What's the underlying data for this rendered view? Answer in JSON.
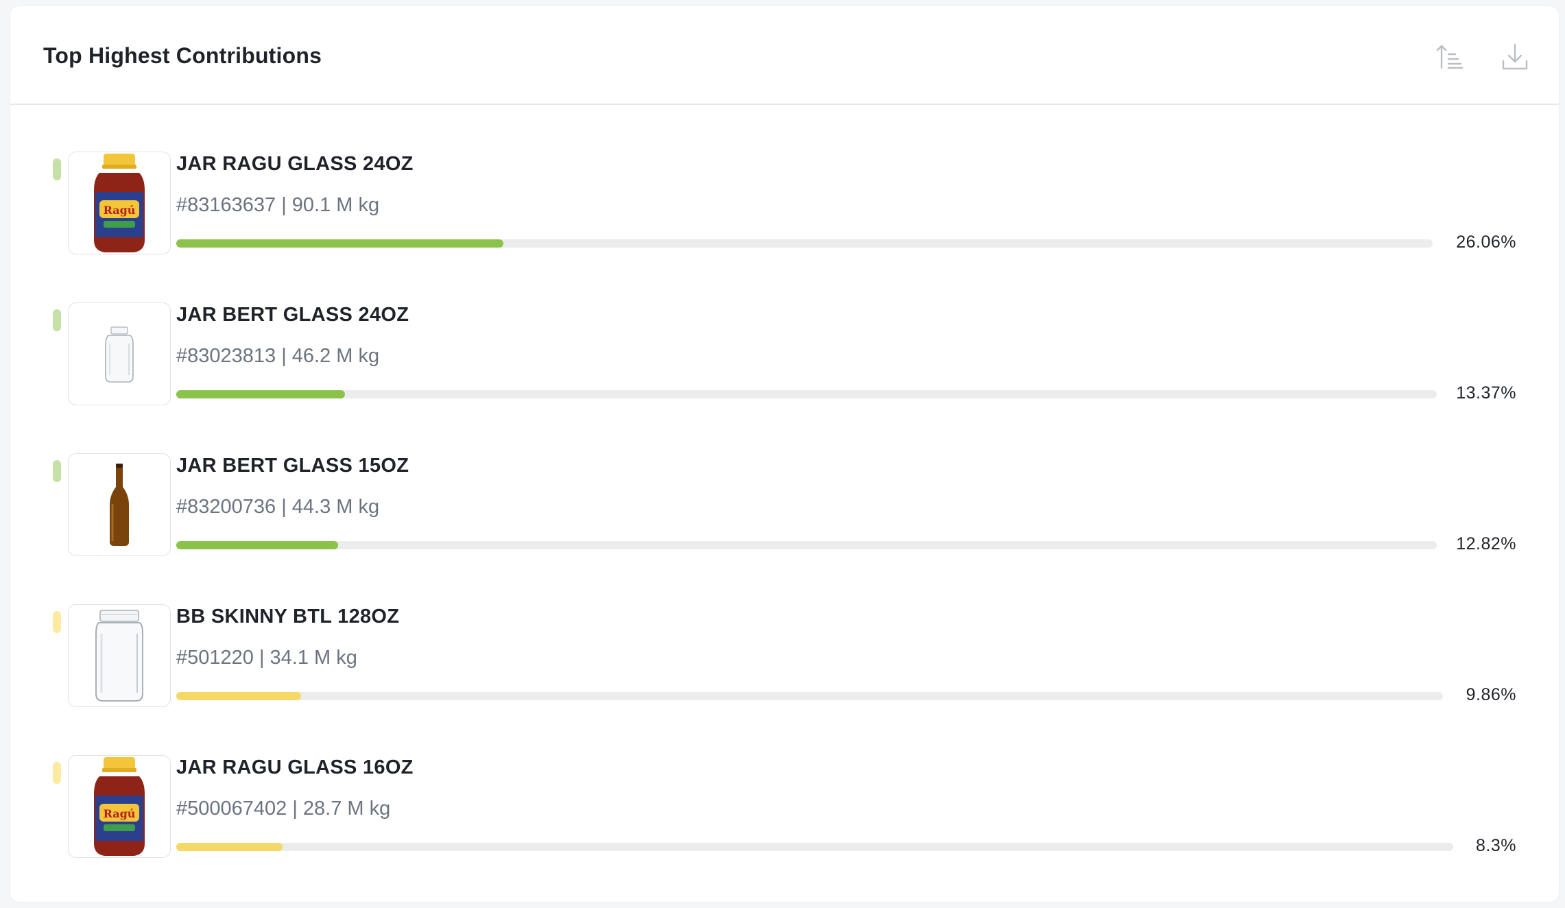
{
  "card": {
    "title": "Top Highest Contributions",
    "sort_icon": "sort-ascending-icon",
    "download_icon": "download-icon"
  },
  "colors": {
    "green": "#8bc34a",
    "green_tick": "#c5e1a5",
    "yellow": "#f5d865",
    "yellow_tick": "#fbeaa0",
    "track": "#ececed"
  },
  "items": [
    {
      "name": "JAR RAGU GLASS 24OZ",
      "meta": "#83163637 | 90.1 M kg",
      "percent_label": "26.06%",
      "percent": 26.06,
      "level": "green",
      "image": "ragu-jar-image"
    },
    {
      "name": "JAR BERT GLASS 24OZ",
      "meta": "#83023813 | 46.2 M kg",
      "percent_label": "13.37%",
      "percent": 13.37,
      "level": "green",
      "image": "clear-jar-image"
    },
    {
      "name": "JAR BERT GLASS 15OZ",
      "meta": "#83200736 | 44.3 M kg",
      "percent_label": "12.82%",
      "percent": 12.82,
      "level": "green",
      "image": "amber-bottle-image"
    },
    {
      "name": "BB SKINNY BTL 128OZ",
      "meta": "#501220 | 34.1 M kg",
      "percent_label": "9.86%",
      "percent": 9.86,
      "level": "yellow",
      "image": "large-clear-jar-image"
    },
    {
      "name": "JAR RAGU GLASS 16OZ",
      "meta": "#500067402 | 28.7 M kg",
      "percent_label": "8.3%",
      "percent": 8.3,
      "level": "yellow",
      "image": "ragu-jar-image"
    }
  ]
}
